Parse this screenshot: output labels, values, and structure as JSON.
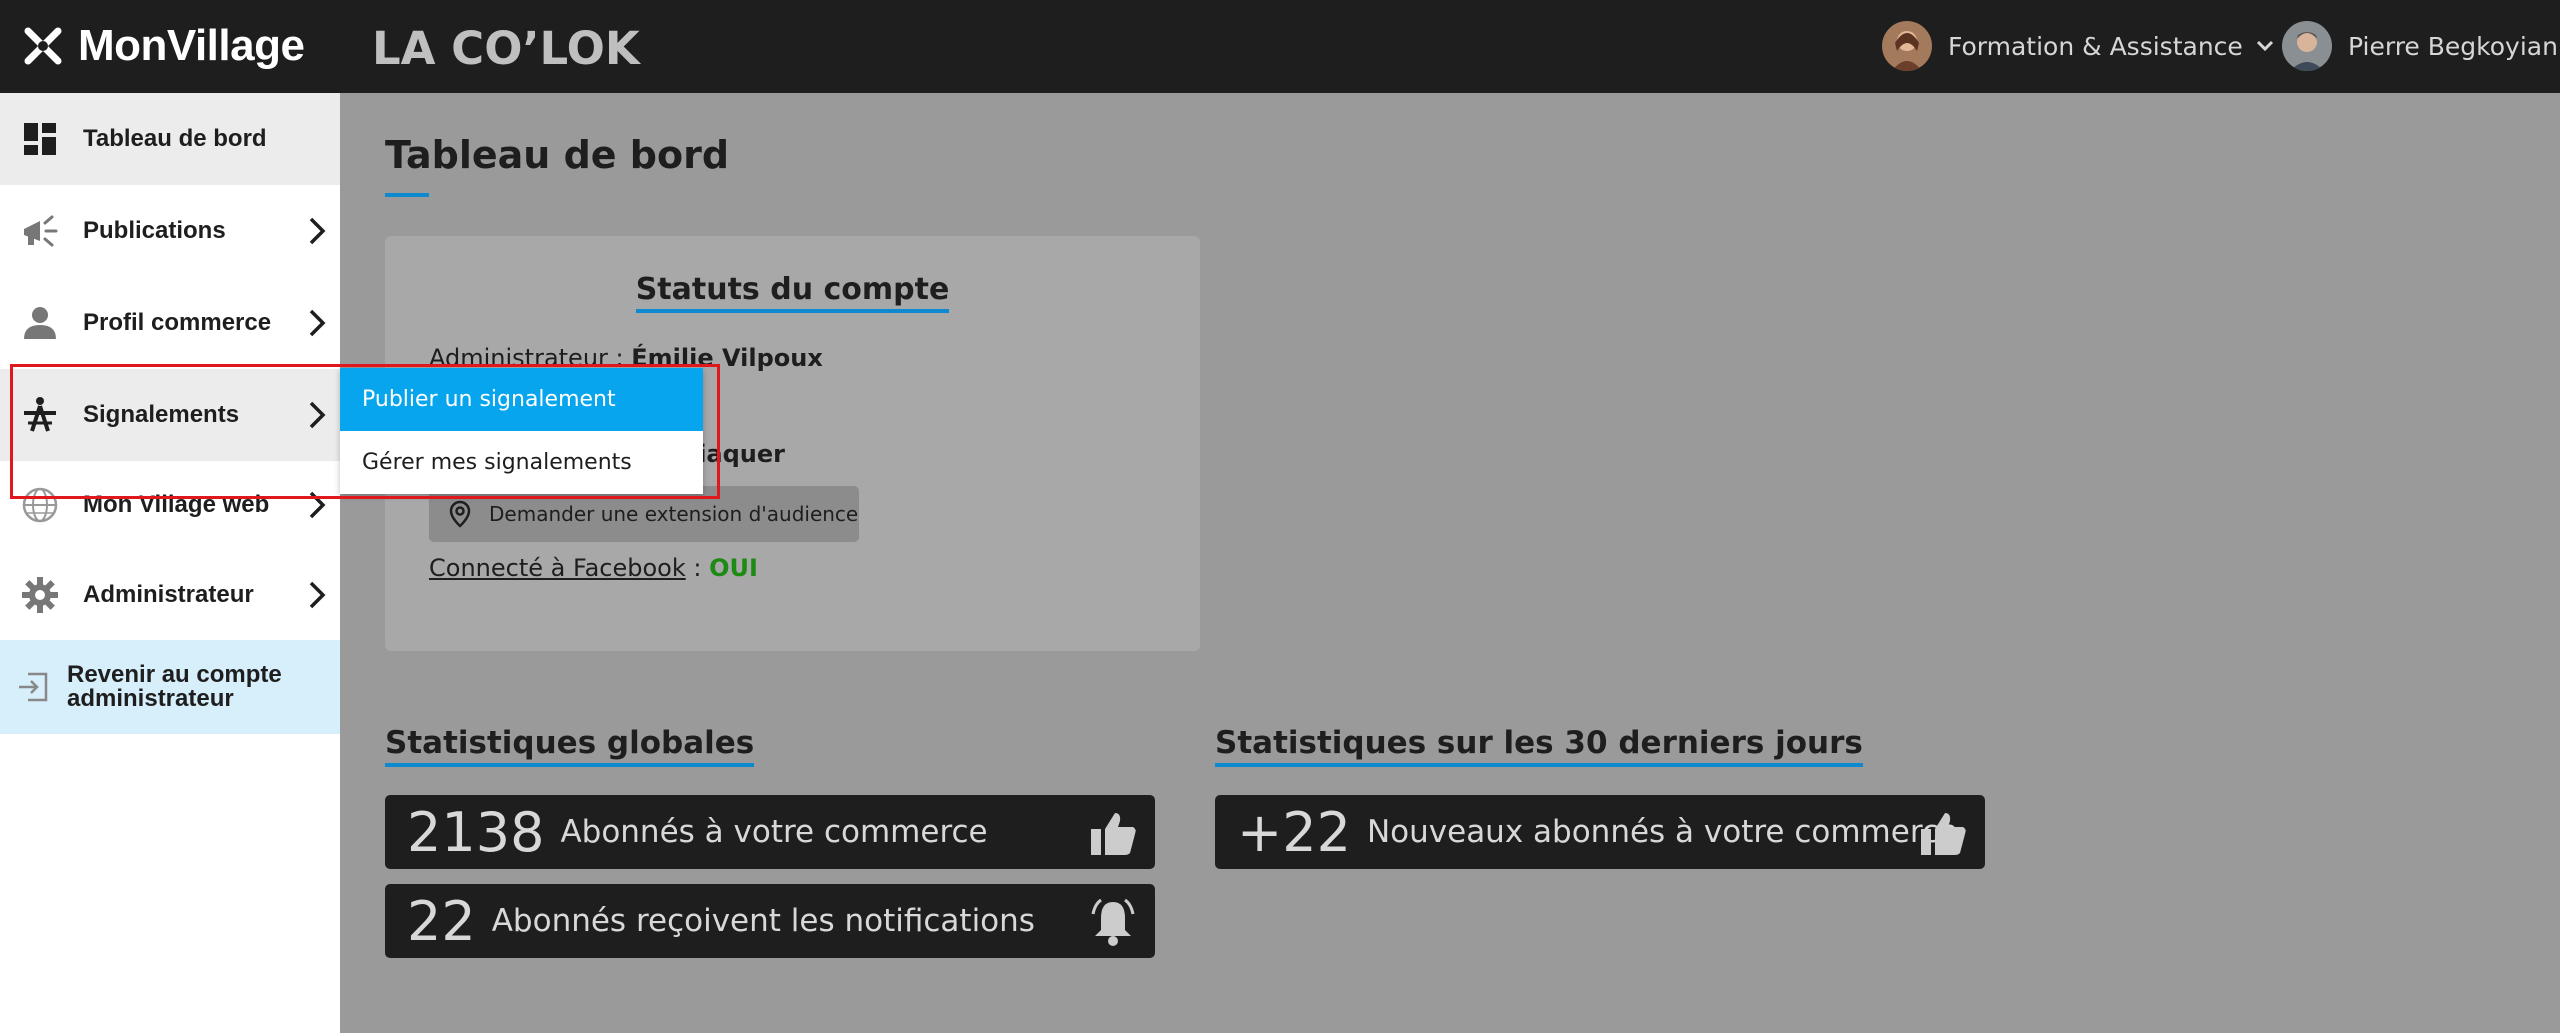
{
  "header": {
    "brand": "MonVillage",
    "shop_name": "LA CO’LOK",
    "support_menu": "Formation & Assistance",
    "user_name": "Pierre Begkoyian"
  },
  "sidebar": {
    "items": [
      {
        "label": "Tableau de bord",
        "icon": "dashboard-icon"
      },
      {
        "label": "Publications",
        "icon": "megaphone-icon"
      },
      {
        "label": "Profil commerce",
        "icon": "person-icon"
      },
      {
        "label": "Signalements",
        "icon": "roadwork-icon"
      },
      {
        "label": "Mon Village web",
        "icon": "globe-icon"
      },
      {
        "label": "Administrateur",
        "icon": "gear-icon"
      }
    ],
    "back_line1": "Revenir au compte",
    "back_line2": "administrateur"
  },
  "flyout": {
    "items": [
      "Publier un signalement",
      "Gérer mes signalements"
    ]
  },
  "main": {
    "title": "Tableau de bord",
    "account": {
      "title": "Statuts du compte",
      "admin_label": "Administrateur : ",
      "admin_name": "Émilie Vilpoux",
      "hidden_fragment": "ariaquer",
      "audience_button": "Demander une extension d'audience",
      "facebook_label": "Connecté à Facebook",
      "facebook_sep": " : ",
      "facebook_value": "OUI"
    },
    "global_stats": {
      "title": "Statistiques globales",
      "rows": [
        {
          "value": "2138",
          "label": "Abonnés à votre commerce",
          "icon": "thumbs-up-icon"
        },
        {
          "value": "22",
          "label": "Abonnés reçoivent les notifications",
          "icon": "bell-icon"
        }
      ]
    },
    "recent_stats": {
      "title": "Statistiques sur les 30 derniers jours",
      "rows": [
        {
          "value": "+22",
          "label": "Nouveaux abonnés à votre commerce",
          "icon": "thumbs-up-icon"
        }
      ]
    }
  },
  "colors": {
    "accent": "#0c89cf",
    "flyout_active": "#07a5ee",
    "highlight": "#e0171d",
    "ok": "#1d8a14"
  }
}
